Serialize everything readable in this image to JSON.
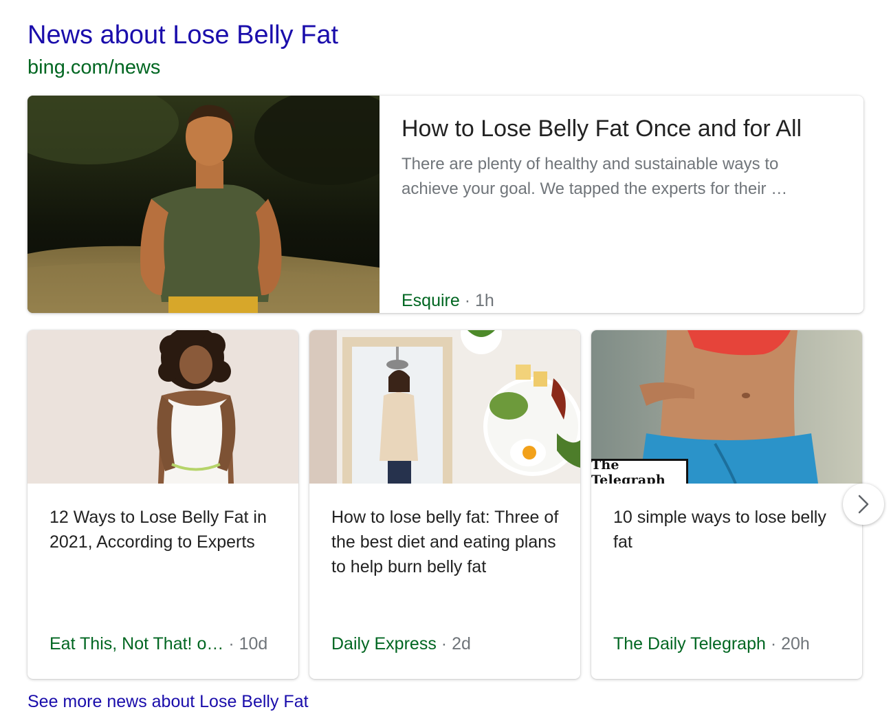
{
  "header": {
    "title": "News about Lose Belly Fat",
    "source": "bing.com/news"
  },
  "featured": {
    "title": "How to Lose Belly Fat Once and for All",
    "snippet": "There are plenty of healthy and sustainable ways to achieve your goal. We tapped the experts for their …",
    "source": "Esquire",
    "separator": "·",
    "age": "1h"
  },
  "cards": [
    {
      "title": "12 Ways to Lose Belly Fat in 2021, According to Experts",
      "source": "Eat This, Not That! o…",
      "separator": "·",
      "age": "10d"
    },
    {
      "title": "How to lose belly fat: Three of the best diet and eating plans to help burn belly fat",
      "source": "Daily Express",
      "separator": "·",
      "age": "2d"
    },
    {
      "title": "10 simple ways to lose belly fat",
      "source": "The Daily Telegraph",
      "separator": "·",
      "age": "20h",
      "logo_text": "The Telegraph"
    }
  ],
  "next_icon": "chevron-right-icon",
  "footer": {
    "see_more": "See more news about Lose Belly Fat"
  },
  "colors": {
    "link_blue": "#1a0dab",
    "url_green": "#006621",
    "snippet_gray": "#70757a"
  }
}
